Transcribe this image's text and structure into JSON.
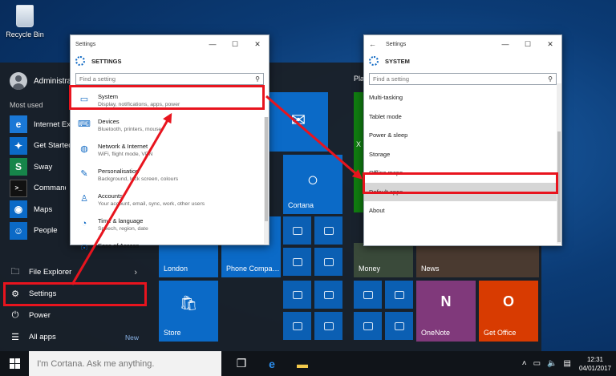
{
  "desktop": {
    "recycle_bin": "Recycle Bin"
  },
  "start": {
    "user": "Administrator",
    "most_used_header": "Most used",
    "apps": [
      {
        "label": "Internet Explorer",
        "icon": "internet-explorer-icon",
        "color": "#1a78d6",
        "glyph": "e"
      },
      {
        "label": "Get Started",
        "icon": "bulb-icon",
        "color": "#0b6ac7",
        "glyph": "💡"
      },
      {
        "label": "Sway",
        "icon": "sway-icon",
        "color": "#16854a",
        "glyph": "S"
      },
      {
        "label": "Command Prompt",
        "icon": "cmd-icon",
        "color": "#111111",
        "glyph": ">_"
      },
      {
        "label": "Maps",
        "icon": "maps-icon",
        "color": "#0b6ac7",
        "glyph": "◉"
      },
      {
        "label": "People",
        "icon": "people-icon",
        "color": "#0b6ac7",
        "glyph": "👥"
      }
    ],
    "bottom": {
      "file_explorer": "File Explorer",
      "settings": "Settings",
      "power": "Power",
      "all_apps": "All apps",
      "new_badge": "New"
    },
    "tiles": {
      "play_header": "Play",
      "cortana": "Cortana",
      "london": "London",
      "phone_companion": "Phone Compa…",
      "store": "Store",
      "money": "Money",
      "news": "News",
      "onenote": "OneNote",
      "get_office": "Get Office",
      "xbox_partial": "X"
    }
  },
  "settings_left": {
    "window_title": "Settings",
    "heading": "SETTINGS",
    "search_placeholder": "Find a setting",
    "items": [
      {
        "title": "System",
        "sub": "Display, notifications, apps, power",
        "icon": "laptop-icon",
        "glyph": "💻"
      },
      {
        "title": "Devices",
        "sub": "Bluetooth, printers, mouse",
        "icon": "devices-icon",
        "glyph": "⌨"
      },
      {
        "title": "Network & Internet",
        "sub": "WiFi, flight mode, VPN",
        "icon": "globe-icon",
        "glyph": "🌐"
      },
      {
        "title": "Personalisation",
        "sub": "Background, lock screen, colours",
        "icon": "personalise-icon",
        "glyph": "🖌"
      },
      {
        "title": "Accounts",
        "sub": "Your account, email, sync, work, other users",
        "icon": "person-icon",
        "glyph": "👤"
      },
      {
        "title": "Time & language",
        "sub": "Speech, region, date",
        "icon": "clock-icon",
        "glyph": "🕒"
      },
      {
        "title": "Ease of Access",
        "sub": "",
        "icon": "access-icon",
        "glyph": "☉"
      }
    ]
  },
  "settings_right": {
    "window_title": "Settings",
    "back_glyph": "←",
    "heading": "SYSTEM",
    "search_placeholder": "Find a setting",
    "items": [
      {
        "label": "Multi-tasking"
      },
      {
        "label": "Tablet mode"
      },
      {
        "label": "Power & sleep"
      },
      {
        "label": "Storage"
      },
      {
        "label": "Offline maps"
      },
      {
        "label": "Default apps"
      },
      {
        "label": "About"
      }
    ]
  },
  "taskbar": {
    "cortana_placeholder": "I'm Cortana. Ask me anything.",
    "time": "12:31",
    "date": "04/01/2017"
  },
  "colors": {
    "highlight": "#e8141e",
    "accent": "#0b66c2"
  }
}
